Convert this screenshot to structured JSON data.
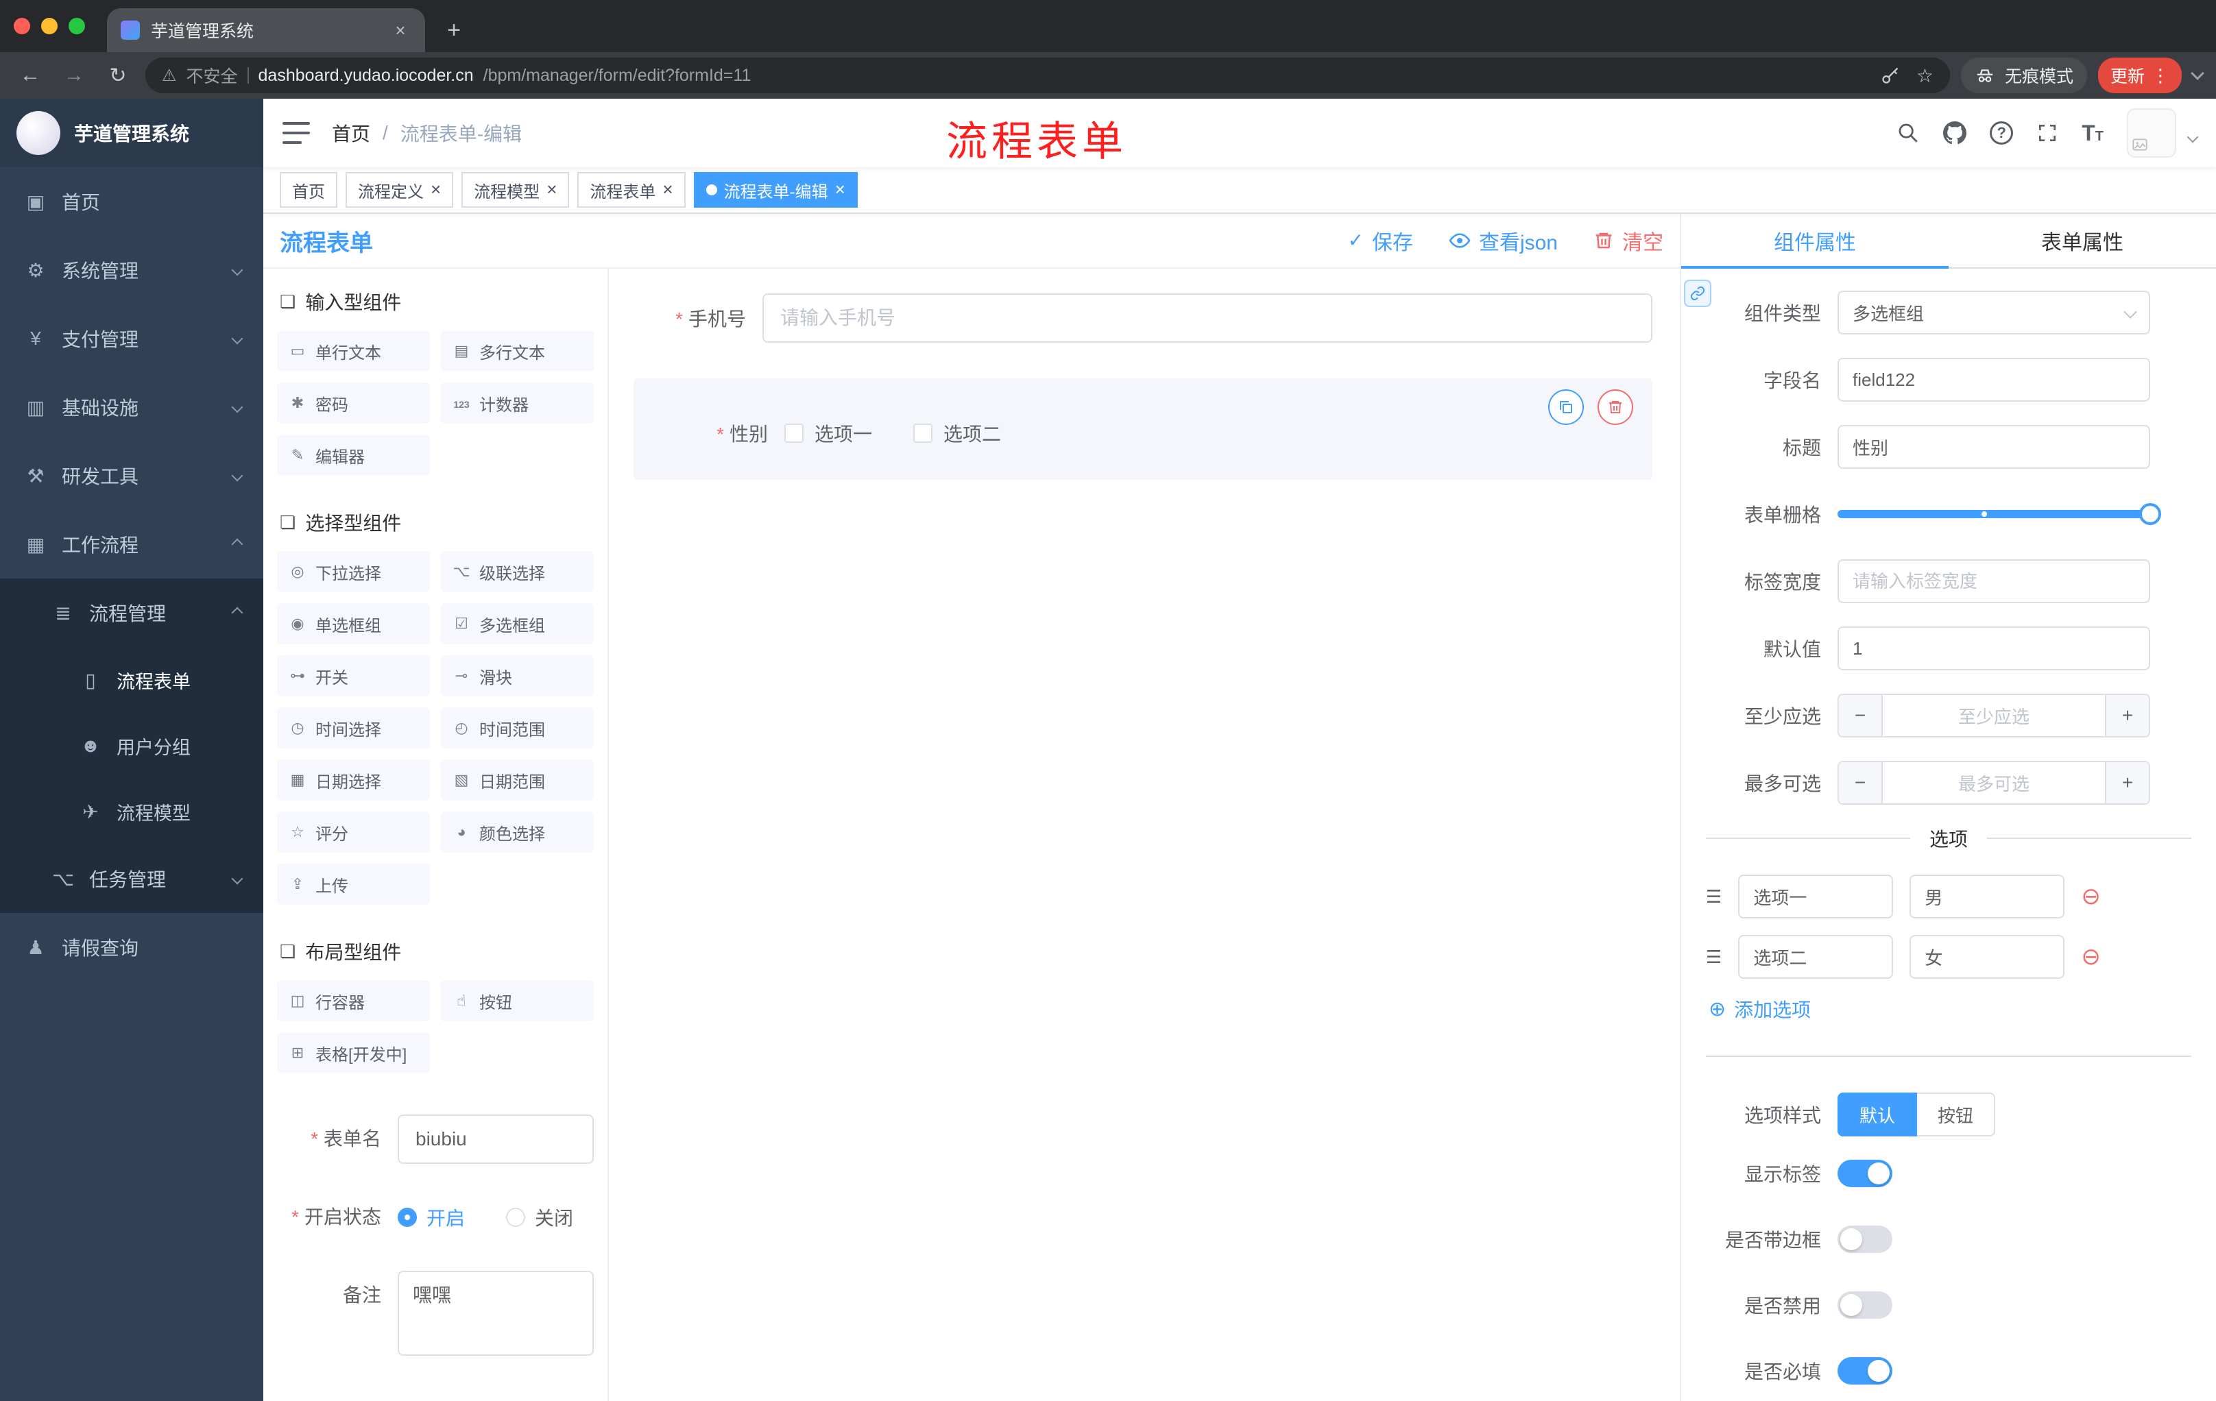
{
  "colors": {
    "primary": "#409eff",
    "danger": "#f56c6c",
    "annotation": "#ff1f1f",
    "sidebar_bg": "#304156",
    "sidebar_sub_bg": "#1f2d3d",
    "active_tag_bg": "#409eff",
    "update_badge_bg": "#e5493d"
  },
  "browser": {
    "tab_title": "芋道管理系统",
    "security_label": "不安全",
    "url_host": "dashboard.yudao.iocoder.cn",
    "url_path": "/bpm/manager/form/edit?formId=11",
    "incognito_label": "无痕模式",
    "update_label": "更新"
  },
  "sidebar": {
    "logo_title": "芋道管理系统",
    "menu": [
      {
        "label": "首页",
        "icon": "home-icon"
      },
      {
        "label": "系统管理",
        "icon": "gear-icon",
        "chevron": "down"
      },
      {
        "label": "支付管理",
        "icon": "payment-icon",
        "chevron": "down"
      },
      {
        "label": "基础设施",
        "icon": "infrastructure-icon",
        "chevron": "down"
      },
      {
        "label": "研发工具",
        "icon": "devtools-icon",
        "chevron": "down"
      },
      {
        "label": "工作流程",
        "icon": "workflow-icon",
        "chevron": "up"
      }
    ],
    "process_group": {
      "label": "流程管理",
      "icon": "process-list-icon",
      "chevron": "up"
    },
    "process_children": [
      {
        "label": "流程表单",
        "icon": "form-document-icon",
        "active": true
      },
      {
        "label": "用户分组",
        "icon": "user-group-icon"
      },
      {
        "label": "流程模型",
        "icon": "process-model-icon"
      }
    ],
    "task_group": {
      "label": "任务管理",
      "icon": "task-icon",
      "chevron": "down"
    },
    "leave_item": {
      "label": "请假查询",
      "icon": "person-icon"
    }
  },
  "navbar": {
    "breadcrumb": [
      "首页",
      "流程表单-编辑"
    ],
    "annotation": "流程表单"
  },
  "tags_view": [
    {
      "label": "首页",
      "closable": false,
      "active": false
    },
    {
      "label": "流程定义",
      "closable": true,
      "active": false
    },
    {
      "label": "流程模型",
      "closable": true,
      "active": false
    },
    {
      "label": "流程表单",
      "closable": true,
      "active": false
    },
    {
      "label": "流程表单-编辑",
      "closable": true,
      "active": true
    }
  ],
  "designer": {
    "title": "流程表单",
    "actions": {
      "save": "保存",
      "view_json": "查看json",
      "clear": "清空"
    },
    "palette": {
      "groups": [
        {
          "title": "输入型组件",
          "items": [
            {
              "label": "单行文本",
              "icon": "single-line-text-icon"
            },
            {
              "label": "多行文本",
              "icon": "multi-line-text-icon"
            },
            {
              "label": "密码",
              "icon": "password-icon"
            },
            {
              "label": "计数器",
              "icon": "counter-icon"
            },
            {
              "label": "编辑器",
              "icon": "editor-icon"
            }
          ]
        },
        {
          "title": "选择型组件",
          "items": [
            {
              "label": "下拉选择",
              "icon": "select-icon"
            },
            {
              "label": "级联选择",
              "icon": "cascader-icon"
            },
            {
              "label": "单选框组",
              "icon": "radio-group-icon"
            },
            {
              "label": "多选框组",
              "icon": "checkbox-group-icon"
            },
            {
              "label": "开关",
              "icon": "switch-icon"
            },
            {
              "label": "滑块",
              "icon": "slider-icon"
            },
            {
              "label": "时间选择",
              "icon": "time-picker-icon"
            },
            {
              "label": "时间范围",
              "icon": "time-range-icon"
            },
            {
              "label": "日期选择",
              "icon": "date-picker-icon"
            },
            {
              "label": "日期范围",
              "icon": "date-range-icon"
            },
            {
              "label": "评分",
              "icon": "rate-icon"
            },
            {
              "label": "颜色选择",
              "icon": "color-picker-icon"
            },
            {
              "label": "上传",
              "icon": "upload-icon"
            }
          ]
        },
        {
          "title": "布局型组件",
          "items": [
            {
              "label": "行容器",
              "icon": "row-container-icon"
            },
            {
              "label": "按钮",
              "icon": "button-icon"
            },
            {
              "label": "表格[开发中]",
              "icon": "table-icon"
            }
          ]
        }
      ]
    },
    "form_meta": {
      "name_label": "表单名",
      "name_value": "biubiu",
      "status_label": "开启状态",
      "status_on": "开启",
      "status_off": "关闭",
      "status_selected": "开启",
      "remark_label": "备注",
      "remark_value": "嘿嘿"
    },
    "canvas": {
      "phone": {
        "label": "手机号",
        "required": true,
        "placeholder": "请输入手机号"
      },
      "gender": {
        "label": "性别",
        "required": true,
        "options": [
          "选项一",
          "选项二"
        ],
        "selected": true
      }
    }
  },
  "props": {
    "tabs": [
      {
        "label": "组件属性",
        "active": true
      },
      {
        "label": "表单属性",
        "active": false
      }
    ],
    "component_type": {
      "label": "组件类型",
      "value": "多选框组"
    },
    "field_name": {
      "label": "字段名",
      "value": "field122"
    },
    "title": {
      "label": "标题",
      "value": "性别"
    },
    "grid": {
      "label": "表单栅格"
    },
    "label_width": {
      "label": "标签宽度",
      "placeholder": "请输入标签宽度"
    },
    "default_value": {
      "label": "默认值",
      "value": "1"
    },
    "min_select": {
      "label": "至少应选",
      "placeholder": "至少应选"
    },
    "max_select": {
      "label": "最多可选",
      "placeholder": "最多可选"
    },
    "options": {
      "divider": "选项",
      "rows": [
        {
          "label": "选项一",
          "value": "男"
        },
        {
          "label": "选项二",
          "value": "女"
        }
      ],
      "add_label": "添加选项"
    },
    "option_style": {
      "label": "选项样式",
      "choices": [
        "默认",
        "按钮"
      ],
      "selected": "默认"
    },
    "switches": [
      {
        "label": "显示标签",
        "on": true
      },
      {
        "label": "是否带边框",
        "on": false
      },
      {
        "label": "是否禁用",
        "on": false
      },
      {
        "label": "是否必填",
        "on": true
      }
    ]
  }
}
